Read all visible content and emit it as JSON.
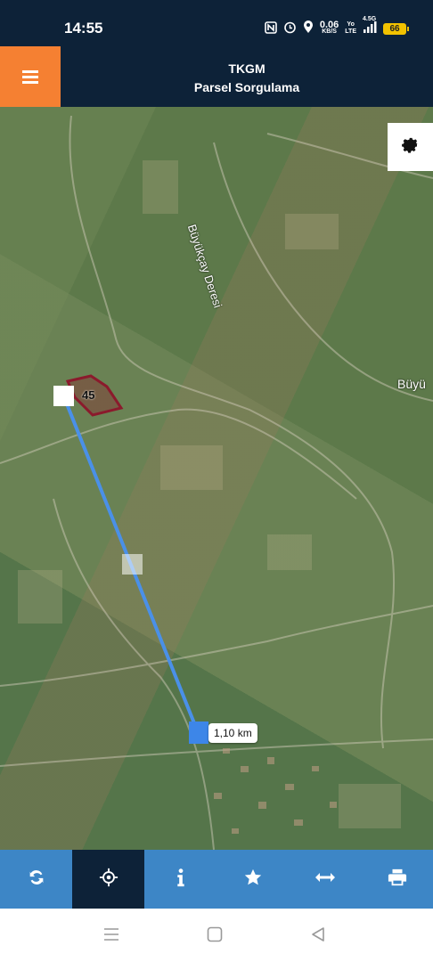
{
  "status_bar": {
    "time": "14:55",
    "network_speed": "0.06",
    "network_unit": "KB/S",
    "volte": "Yo",
    "lte": "LTE",
    "signal": "4.5G",
    "battery": "66"
  },
  "header": {
    "title": "TKGM",
    "subtitle": "Parsel Sorgulama"
  },
  "map": {
    "parcel_number": "45",
    "stream_label": "Büyükçay Deresi",
    "place_label": "Büyü",
    "distance_label": "1,10 km"
  },
  "toolbar": {
    "items": [
      {
        "icon": "refresh-icon"
      },
      {
        "icon": "locate-icon",
        "active": true
      },
      {
        "icon": "info-icon"
      },
      {
        "icon": "star-icon"
      },
      {
        "icon": "measure-icon"
      },
      {
        "icon": "print-icon"
      }
    ]
  },
  "colors": {
    "header_bg": "#0d2238",
    "menu_button": "#f58032",
    "toolbar_bg": "#3d86c6",
    "toolbar_active": "#0d2238",
    "measure_line": "#4a90e8",
    "parcel_outline": "#8b1a2c"
  }
}
